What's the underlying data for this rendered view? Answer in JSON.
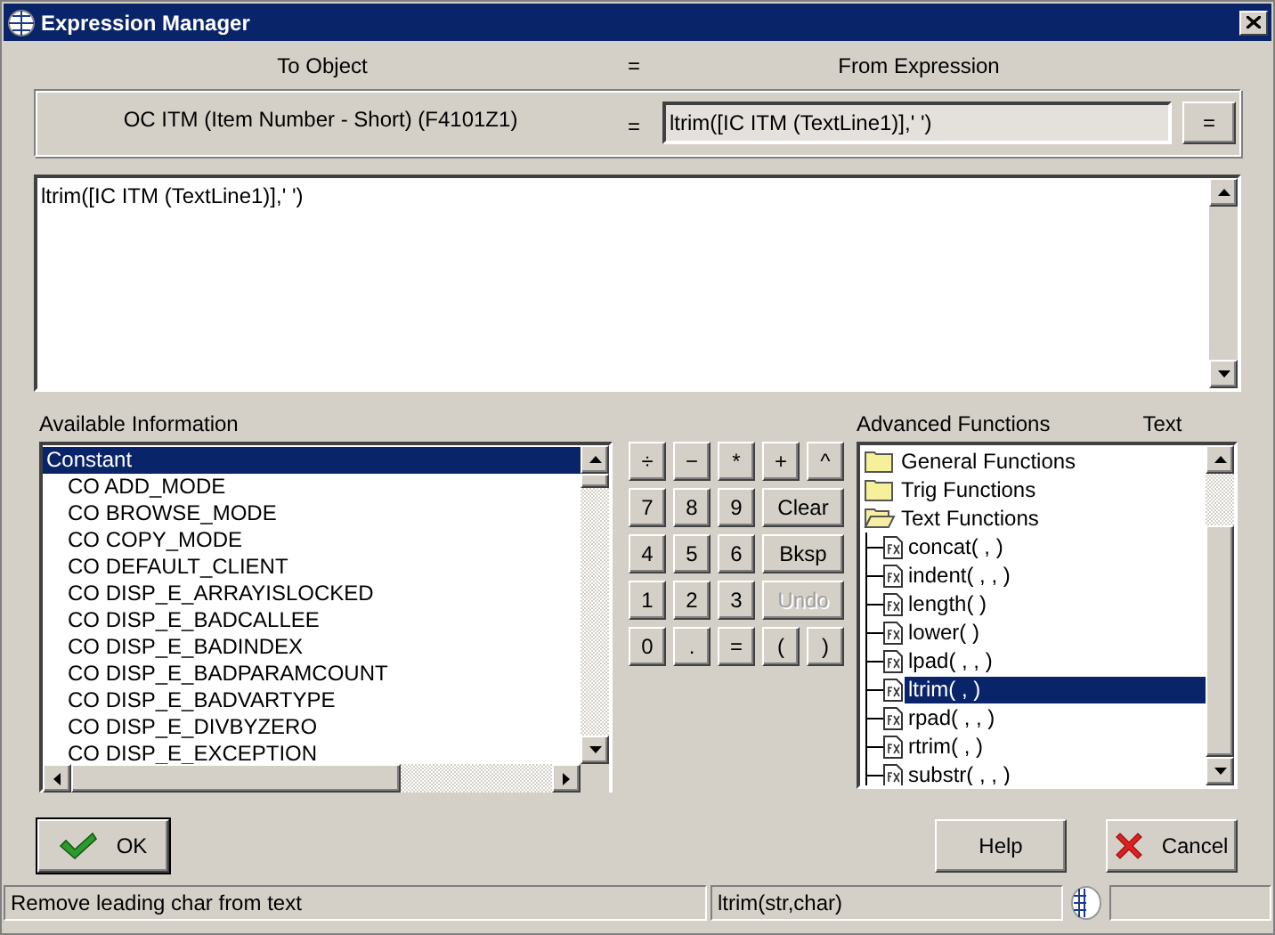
{
  "window": {
    "title": "Expression Manager"
  },
  "assignment": {
    "to_heading": "To Object",
    "equals_heading": "=",
    "from_heading": "From Expression",
    "target": "OC ITM (Item Number - Short) (F4101Z1)",
    "equals": "=",
    "expression": "ltrim([IC ITM (TextLine1)],' ')",
    "assign_button": "="
  },
  "editor": {
    "value": "ltrim([IC ITM (TextLine1)],' ')"
  },
  "available": {
    "label": "Available Information",
    "items": [
      {
        "label": "Constant",
        "selected": true,
        "children": [
          {
            "label": "CO ADD_MODE",
            "selected": false
          },
          {
            "label": "CO BROWSE_MODE",
            "selected": false
          },
          {
            "label": "CO COPY_MODE",
            "selected": false
          },
          {
            "label": "CO DEFAULT_CLIENT",
            "selected": false
          },
          {
            "label": "CO DISP_E_ARRAYISLOCKED",
            "selected": false
          },
          {
            "label": "CO DISP_E_BADCALLEE",
            "selected": false
          },
          {
            "label": "CO DISP_E_BADINDEX",
            "selected": false
          },
          {
            "label": "CO DISP_E_BADPARAMCOUNT",
            "selected": false
          },
          {
            "label": "CO DISP_E_BADVARTYPE",
            "selected": false
          },
          {
            "label": "CO DISP_E_DIVBYZERO",
            "selected": false
          },
          {
            "label": "CO DISP_E_EXCEPTION",
            "selected": false
          }
        ]
      }
    ]
  },
  "keypad": [
    {
      "label": "÷",
      "disabled": false,
      "wide": false
    },
    {
      "label": "−",
      "disabled": false,
      "wide": false
    },
    {
      "label": "*",
      "disabled": false,
      "wide": false
    },
    {
      "label": "+",
      "disabled": false,
      "wide": false
    },
    {
      "label": "^",
      "disabled": false,
      "wide": false
    },
    {
      "label": "7",
      "disabled": false,
      "wide": false
    },
    {
      "label": "8",
      "disabled": false,
      "wide": false
    },
    {
      "label": "9",
      "disabled": false,
      "wide": false
    },
    {
      "label": "Clear",
      "disabled": false,
      "wide": true
    },
    {
      "label": "4",
      "disabled": false,
      "wide": false
    },
    {
      "label": "5",
      "disabled": false,
      "wide": false
    },
    {
      "label": "6",
      "disabled": false,
      "wide": false
    },
    {
      "label": "Bksp",
      "disabled": false,
      "wide": true
    },
    {
      "label": "1",
      "disabled": false,
      "wide": false
    },
    {
      "label": "2",
      "disabled": false,
      "wide": false
    },
    {
      "label": "3",
      "disabled": false,
      "wide": false
    },
    {
      "label": "Undo",
      "disabled": true,
      "wide": true
    },
    {
      "label": "0",
      "disabled": false,
      "wide": false
    },
    {
      "label": ".",
      "disabled": false,
      "wide": false
    },
    {
      "label": "=",
      "disabled": false,
      "wide": false
    },
    {
      "label": "(",
      "disabled": false,
      "wide": false
    },
    {
      "label": ")",
      "disabled": false,
      "wide": false
    }
  ],
  "advanced": {
    "label": "Advanced Functions",
    "category": "Text",
    "items": [
      {
        "label": "General Functions",
        "expanded": false,
        "selected": false
      },
      {
        "label": "Trig Functions",
        "expanded": false,
        "selected": false
      },
      {
        "label": "Text Functions",
        "expanded": true,
        "selected": false,
        "children": [
          {
            "label": "concat( , )",
            "selected": false
          },
          {
            "label": "indent( , , )",
            "selected": false
          },
          {
            "label": "length( )",
            "selected": false
          },
          {
            "label": "lower( )",
            "selected": false
          },
          {
            "label": "lpad( , , )",
            "selected": false
          },
          {
            "label": "ltrim( , )",
            "selected": true
          },
          {
            "label": "rpad( , , )",
            "selected": false
          },
          {
            "label": "rtrim( , )",
            "selected": false
          },
          {
            "label": "substr( , , )",
            "selected": false
          }
        ]
      }
    ]
  },
  "buttons": [
    {
      "kind": "ok",
      "label": "OK"
    },
    {
      "kind": "help",
      "label": "Help"
    },
    {
      "kind": "cancel",
      "label": "Cancel"
    }
  ],
  "status_bar": {
    "description": "Remove leading char from text",
    "syntax": "ltrim(str,char)"
  }
}
